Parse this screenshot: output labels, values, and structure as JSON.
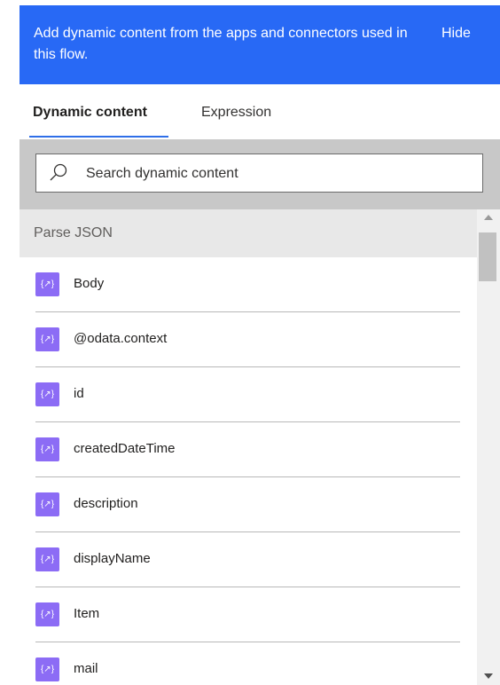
{
  "banner": {
    "message": "Add dynamic content from the apps and connectors used in this flow.",
    "hide_label": "Hide",
    "color": "#2869f5"
  },
  "tabs": [
    {
      "label": "Dynamic content",
      "active": true
    },
    {
      "label": "Expression",
      "active": false
    }
  ],
  "search": {
    "placeholder": "Search dynamic content",
    "icon": "search-icon"
  },
  "section": {
    "title": "Parse JSON"
  },
  "items": [
    {
      "token": "{↗}",
      "label": "Body"
    },
    {
      "token": "{↗}",
      "label": "@odata.context"
    },
    {
      "token": "{↗}",
      "label": "id"
    },
    {
      "token": "{↗}",
      "label": "createdDateTime"
    },
    {
      "token": "{↗}",
      "label": "description"
    },
    {
      "token": "{↗}",
      "label": "displayName"
    },
    {
      "token": "{↗}",
      "label": "Item"
    },
    {
      "token": "{↗}",
      "label": "mail"
    }
  ],
  "token_color": "#8c6cf5"
}
